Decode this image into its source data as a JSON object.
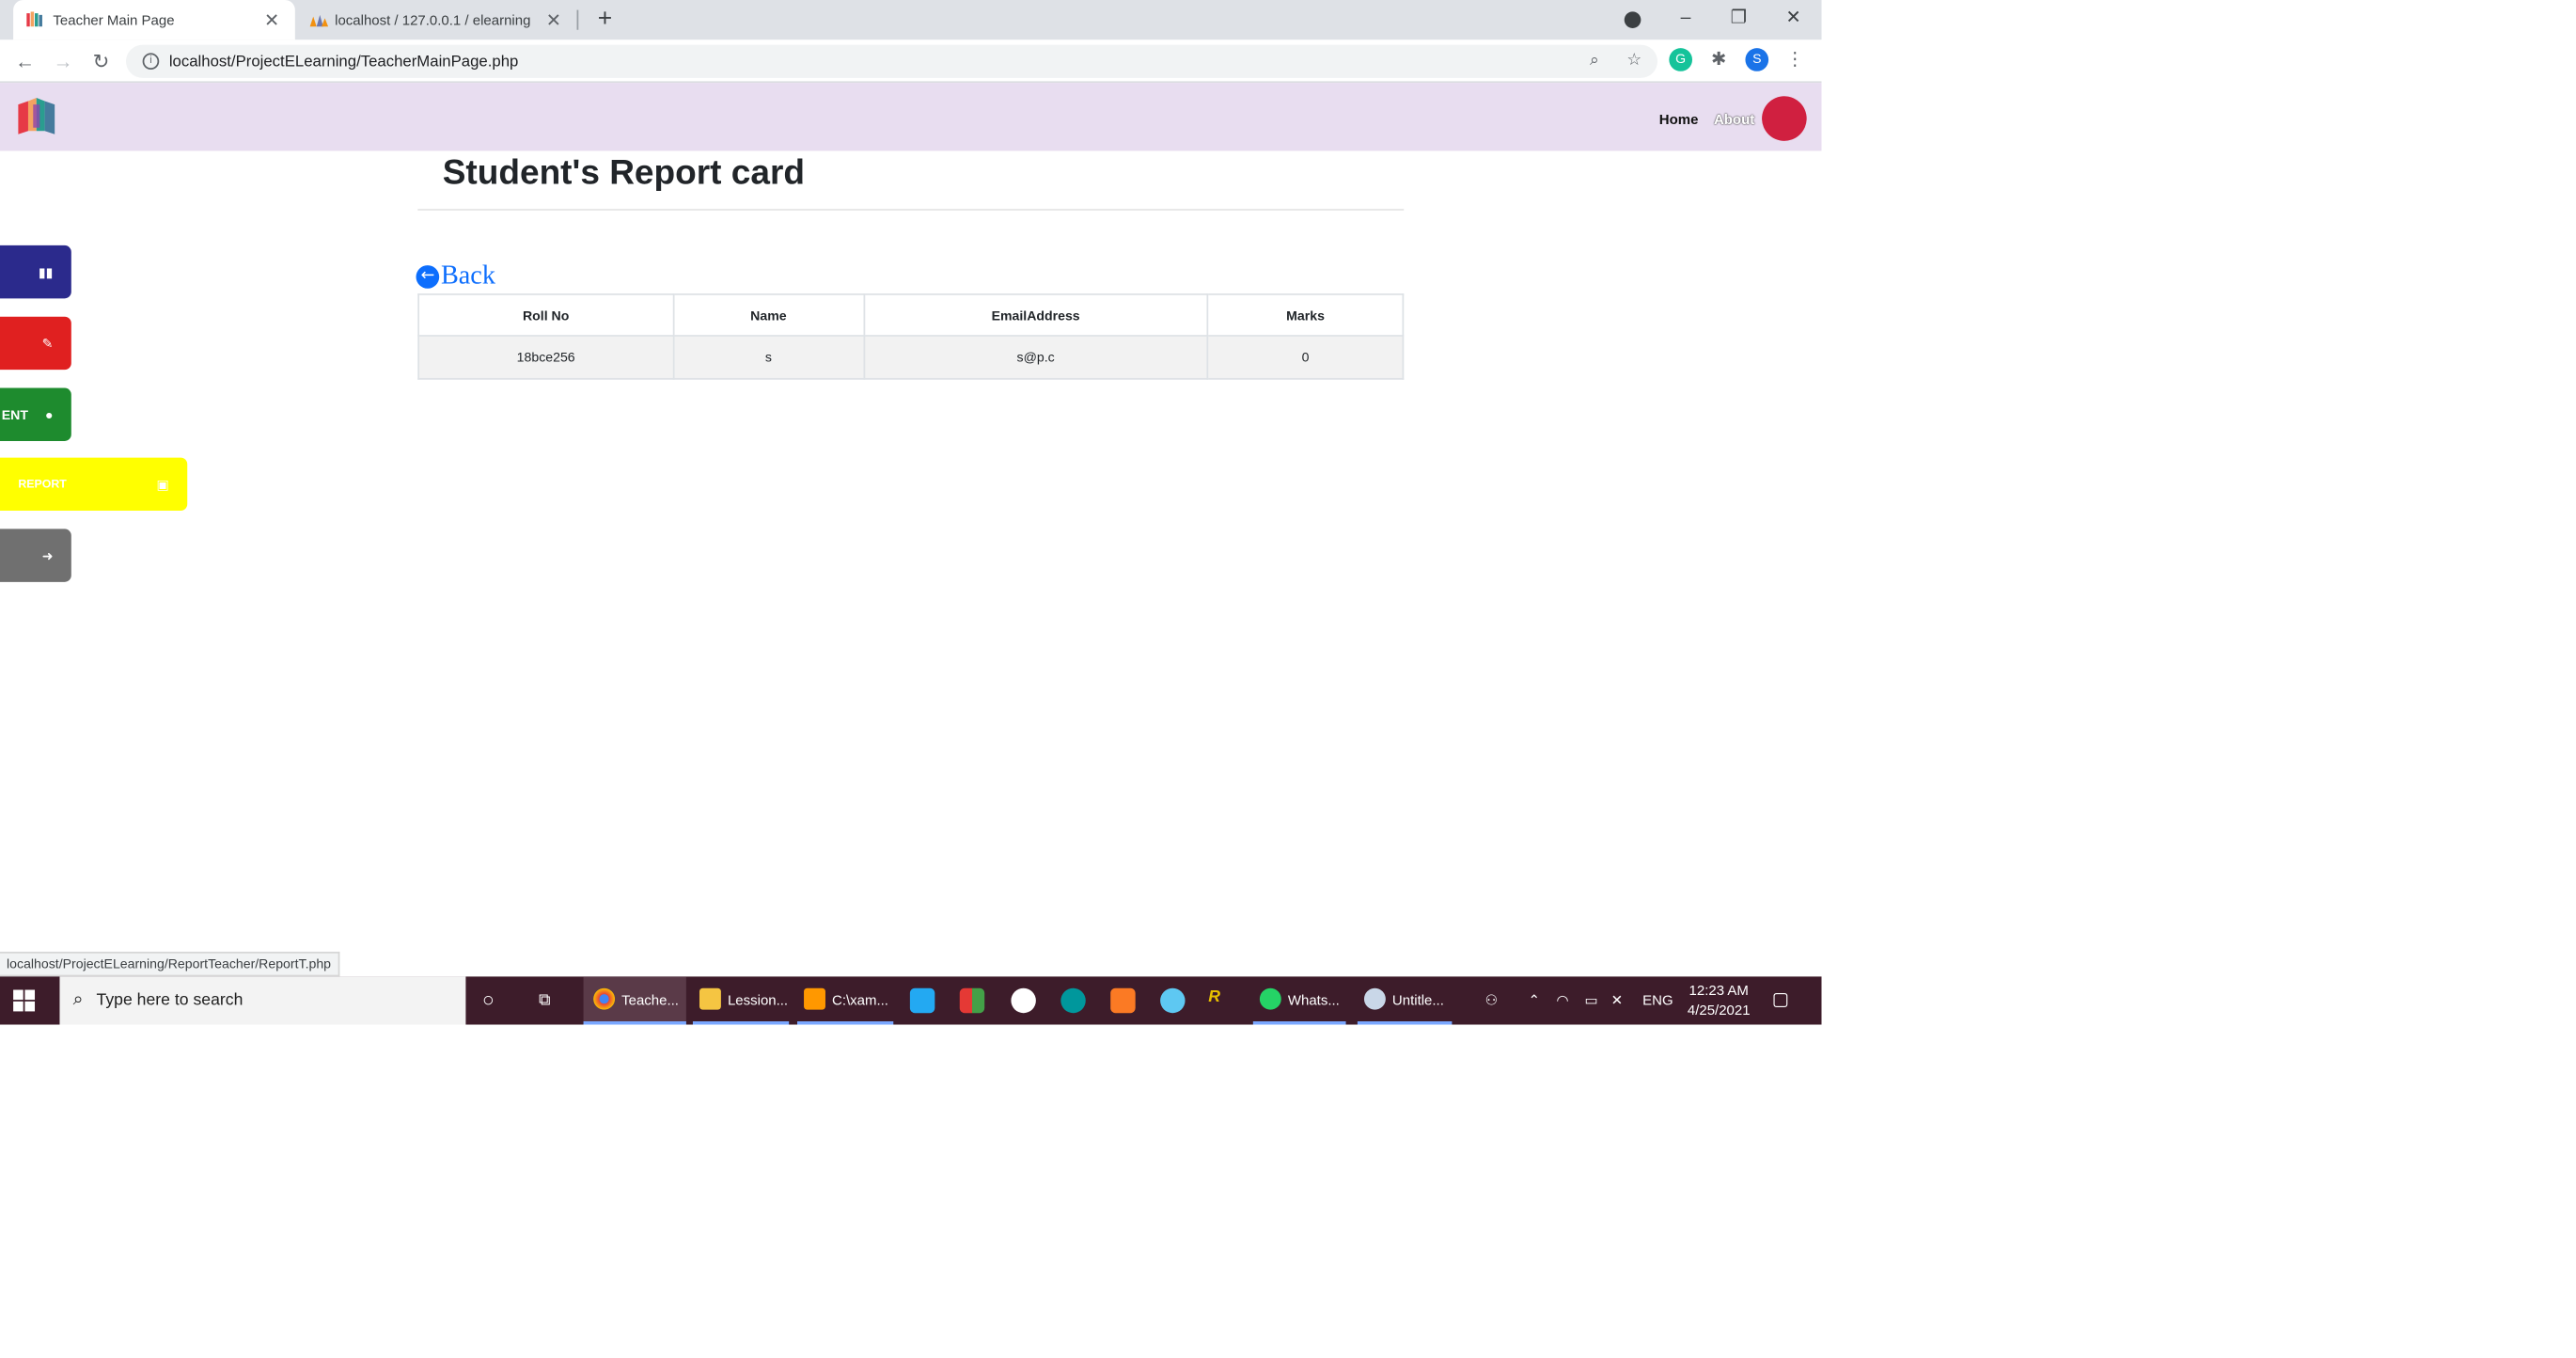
{
  "browser": {
    "tabs": [
      {
        "title": "Teacher Main Page",
        "active": true
      },
      {
        "title": "localhost / 127.0.0.1 / elearning",
        "active": false
      }
    ],
    "new_tab_symbol": "+",
    "window_controls": {
      "minimize": "–",
      "restore": "❐",
      "close": "✕"
    },
    "address": "localhost/ProjectELearning/TeacherMainPage.php",
    "profile_initial": "S",
    "status_url": "localhost/ProjectELearning/ReportTeacher/ReportT.php"
  },
  "navbar": {
    "links": {
      "home": "Home",
      "about": "About"
    },
    "brand_colors": [
      "#e63946",
      "#f4a261",
      "#2a9d8f",
      "#457b9d",
      "#8e44ad"
    ]
  },
  "page": {
    "title": "Student's Report card",
    "back_label": "Back",
    "table": {
      "headers": [
        "Roll No",
        "Name",
        "EmailAddress",
        "Marks"
      ],
      "rows": [
        [
          "18bce256",
          "s",
          "s@p.c",
          "0"
        ]
      ]
    }
  },
  "sidebar": {
    "buttons": [
      {
        "label": "",
        "icon": "book-icon",
        "color": "#2b2a8c"
      },
      {
        "label": "",
        "icon": "pencil-icon",
        "color": "#e02020"
      },
      {
        "label": "ENT",
        "icon": "user-icon",
        "color": "#1e8b2e"
      },
      {
        "label": "REPORT",
        "icon": "report-icon",
        "color": "#ffff00"
      },
      {
        "label": "",
        "icon": "logout-icon",
        "color": "#707070"
      }
    ]
  },
  "taskbar": {
    "search_placeholder": "Type here to search",
    "apps": [
      {
        "label": "Teache...",
        "icon": "chrome-icon"
      },
      {
        "label": "Lession...",
        "icon": "folder-icon"
      },
      {
        "label": "C:\\xam...",
        "icon": "sublime-icon"
      },
      {
        "label": "Whats...",
        "icon": "whatsapp-icon"
      },
      {
        "label": "Untitle...",
        "icon": "paint-icon"
      }
    ],
    "tray": {
      "language": "ENG",
      "time": "12:23 AM",
      "date": "4/25/2021"
    }
  }
}
